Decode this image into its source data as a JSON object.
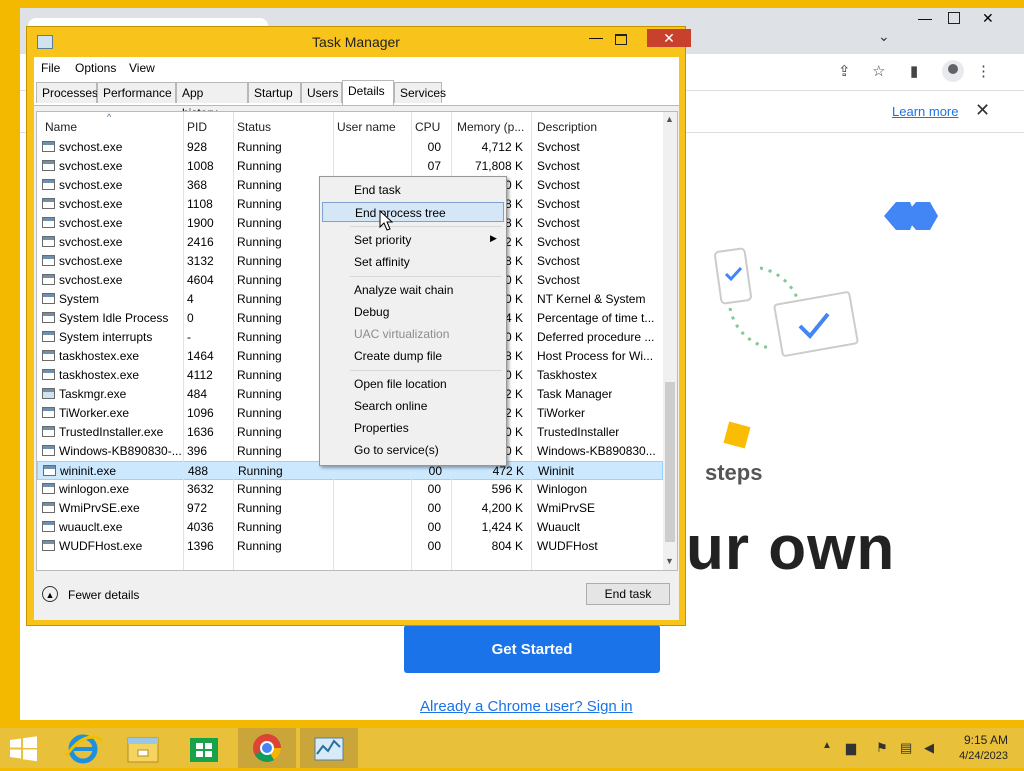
{
  "chrome": {
    "learn_more": "Learn more",
    "hero_text_1": "steps",
    "hero_text_2": "ur own",
    "get_started": "Get Started",
    "signin": "Already a Chrome user? Sign in"
  },
  "taskmanager": {
    "title": "Task Manager",
    "menu": [
      "File",
      "Options",
      "View"
    ],
    "tabs": [
      {
        "label": "Processes"
      },
      {
        "label": "Performance"
      },
      {
        "label": "App history"
      },
      {
        "label": "Startup"
      },
      {
        "label": "Users"
      },
      {
        "label": "Details",
        "active": true
      },
      {
        "label": "Services"
      }
    ],
    "columns": [
      "Name",
      "PID",
      "Status",
      "User name",
      "CPU",
      "Memory (p...",
      "Description"
    ],
    "rows": [
      {
        "name": "svchost.exe",
        "pid": "928",
        "status": "Running",
        "user": "",
        "cpu": "00",
        "mem": "4,712 K",
        "desc": "Svchost"
      },
      {
        "name": "svchost.exe",
        "pid": "1008",
        "status": "Running",
        "user": "",
        "cpu": "07",
        "mem": "71,808 K",
        "desc": "Svchost"
      },
      {
        "name": "svchost.exe",
        "pid": "368",
        "status": "Running",
        "user": "",
        "cpu": "",
        "mem": "0 K",
        "desc": "Svchost"
      },
      {
        "name": "svchost.exe",
        "pid": "1108",
        "status": "Running",
        "user": "",
        "cpu": "",
        "mem": "8 K",
        "desc": "Svchost"
      },
      {
        "name": "svchost.exe",
        "pid": "1900",
        "status": "Running",
        "user": "",
        "cpu": "",
        "mem": "8 K",
        "desc": "Svchost"
      },
      {
        "name": "svchost.exe",
        "pid": "2416",
        "status": "Running",
        "user": "",
        "cpu": "",
        "mem": "2 K",
        "desc": "Svchost"
      },
      {
        "name": "svchost.exe",
        "pid": "3132",
        "status": "Running",
        "user": "",
        "cpu": "",
        "mem": "8 K",
        "desc": "Svchost"
      },
      {
        "name": "svchost.exe",
        "pid": "4604",
        "status": "Running",
        "user": "",
        "cpu": "",
        "mem": "0 K",
        "desc": "Svchost"
      },
      {
        "name": "System",
        "pid": "4",
        "status": "Running",
        "user": "",
        "cpu": "",
        "mem": "0 K",
        "desc": "NT Kernel & System"
      },
      {
        "name": "System Idle Process",
        "pid": "0",
        "status": "Running",
        "user": "",
        "cpu": "",
        "mem": "4 K",
        "desc": "Percentage of time t..."
      },
      {
        "name": "System interrupts",
        "pid": "-",
        "status": "Running",
        "user": "",
        "cpu": "",
        "mem": "0 K",
        "desc": "Deferred procedure ..."
      },
      {
        "name": "taskhostex.exe",
        "pid": "1464",
        "status": "Running",
        "user": "",
        "cpu": "",
        "mem": "8 K",
        "desc": "Host Process for Wi..."
      },
      {
        "name": "taskhostex.exe",
        "pid": "4112",
        "status": "Running",
        "user": "",
        "cpu": "",
        "mem": "0 K",
        "desc": "Taskhostex"
      },
      {
        "name": "Taskmgr.exe",
        "pid": "484",
        "status": "Running",
        "user": "",
        "cpu": "",
        "mem": "2 K",
        "desc": "Task Manager",
        "icon": "taskmgr"
      },
      {
        "name": "TiWorker.exe",
        "pid": "1096",
        "status": "Running",
        "user": "",
        "cpu": "",
        "mem": "2 K",
        "desc": "TiWorker"
      },
      {
        "name": "TrustedInstaller.exe",
        "pid": "1636",
        "status": "Running",
        "user": "",
        "cpu": "",
        "mem": "0 K",
        "desc": "TrustedInstaller"
      },
      {
        "name": "Windows-KB890830-...",
        "pid": "396",
        "status": "Running",
        "user": "",
        "cpu": "",
        "mem": "0 K",
        "desc": "Windows-KB890830..."
      },
      {
        "name": "wininit.exe",
        "pid": "488",
        "status": "Running",
        "user": "",
        "cpu": "00",
        "mem": "472 K",
        "desc": "Wininit",
        "selected": true
      },
      {
        "name": "winlogon.exe",
        "pid": "3632",
        "status": "Running",
        "user": "",
        "cpu": "00",
        "mem": "596 K",
        "desc": "Winlogon"
      },
      {
        "name": "WmiPrvSE.exe",
        "pid": "972",
        "status": "Running",
        "user": "",
        "cpu": "00",
        "mem": "4,200 K",
        "desc": "WmiPrvSE"
      },
      {
        "name": "wuauclt.exe",
        "pid": "4036",
        "status": "Running",
        "user": "",
        "cpu": "00",
        "mem": "1,424 K",
        "desc": "Wuauclt"
      },
      {
        "name": "WUDFHost.exe",
        "pid": "1396",
        "status": "Running",
        "user": "",
        "cpu": "00",
        "mem": "804 K",
        "desc": "WUDFHost"
      }
    ],
    "fewer_details": "Fewer details",
    "end_task": "End task"
  },
  "context_menu": {
    "items": [
      {
        "label": "End task"
      },
      {
        "label": "End process tree",
        "hover": true
      },
      {
        "sep": true
      },
      {
        "label": "Set priority",
        "submenu": true
      },
      {
        "label": "Set affinity"
      },
      {
        "sep": true
      },
      {
        "label": "Analyze wait chain"
      },
      {
        "label": "Debug"
      },
      {
        "label": "UAC virtualization",
        "disabled": true
      },
      {
        "label": "Create dump file"
      },
      {
        "sep": true
      },
      {
        "label": "Open file location"
      },
      {
        "label": "Search online"
      },
      {
        "label": "Properties"
      },
      {
        "label": "Go to service(s)"
      }
    ]
  },
  "taskbar": {
    "apps": [
      "start-icon",
      "internet-explorer-icon",
      "file-explorer-icon",
      "store-icon",
      "chrome-icon",
      "task-manager-icon"
    ],
    "time": "9:15 AM",
    "date": "4/24/2023"
  },
  "colors": {
    "desktop": "#f3b800",
    "selection": "#cce8ff",
    "chrome_blue": "#1a73e8",
    "close_red": "#c8412d"
  }
}
